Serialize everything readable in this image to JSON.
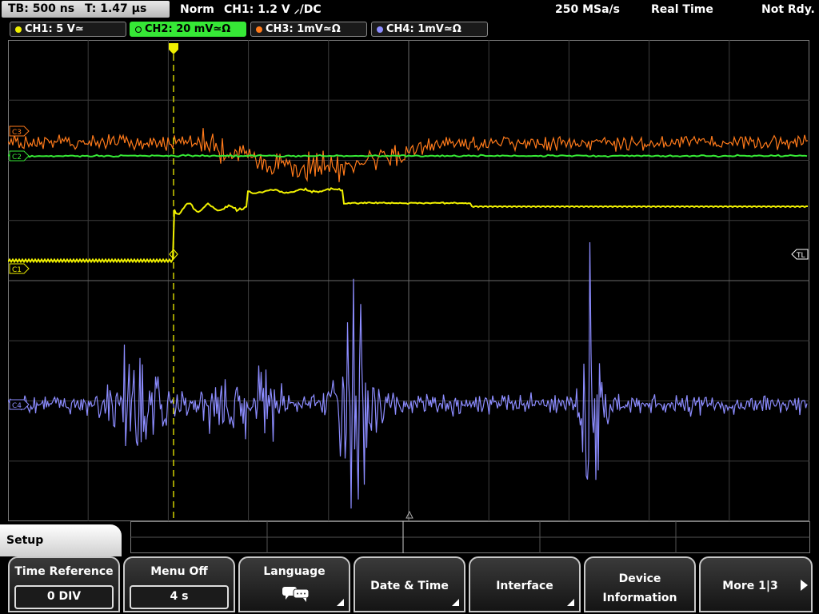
{
  "status": {
    "timebase": "TB: 500 ns",
    "trigger_time": "T: 1.47 µs",
    "mode": "Norm",
    "trigger_info": "CH1: 1.2 V ⸝/DC",
    "sample_rate": "250 MSa/s",
    "acq_mode": "Real Time",
    "state": "Not Rdy."
  },
  "channels": [
    {
      "label": "CH1: 5 V≃",
      "color": "#f0f000"
    },
    {
      "label": "CH2: 20 mV≃Ω",
      "color": "#36e836",
      "active": true
    },
    {
      "label": "CH3: 1mV≃Ω",
      "color": "#ff7a1a"
    },
    {
      "label": "CH4: 1mV≃Ω",
      "color": "#8c8cff"
    }
  ],
  "markers": {
    "c3": "C3",
    "c2": "C2",
    "c1": "C1",
    "c4": "C4",
    "tl": "TL"
  },
  "menu": {
    "title": "Setup",
    "keys": [
      {
        "label": "Time Reference",
        "value": "0 DIV"
      },
      {
        "label": "Menu Off",
        "value": "4 s"
      },
      {
        "label": "Language",
        "icon": "speech-bubbles-icon"
      },
      {
        "label": "Date & Time"
      },
      {
        "label": "Interface"
      },
      {
        "label1": "Device",
        "label2": "Information"
      },
      {
        "label": "More 1|3"
      }
    ]
  },
  "colors": {
    "ch1": "#f0f000",
    "ch2": "#36e836",
    "ch3": "#ff7a1a",
    "ch4": "#8c8cff",
    "grid": "#4a4a4a",
    "trigger": "#f0f000"
  }
}
